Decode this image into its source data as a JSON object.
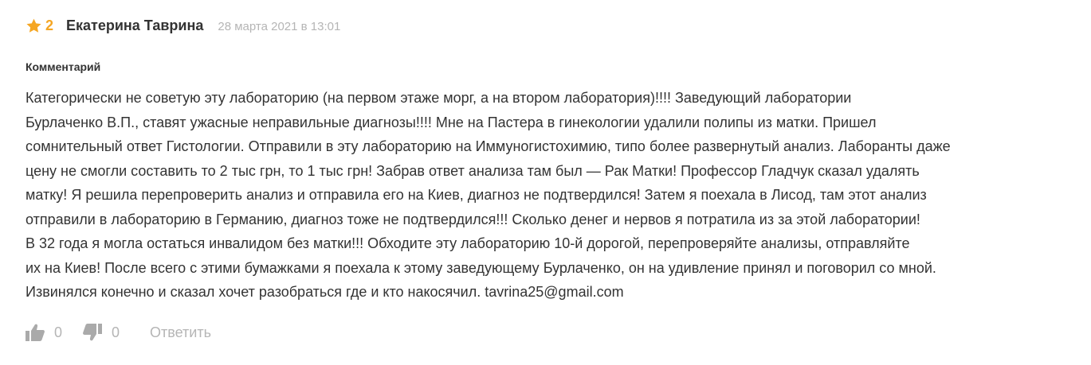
{
  "review": {
    "rating": "2",
    "author": "Екатерина Таврина",
    "date": "28 марта 2021 в 13:01",
    "section_label": "Комментарий",
    "text": "Категорически не советую эту лабораторию (на первом этаже морг, а на втором лаборатория)!!!! Заведующий лаборатории\nБурлаченко В.П., ставят ужасные неправильные диагнозы!!!! Мне на Пастера в гинекологии удалили полипы из матки. Пришел\nсомнительный ответ Гистологии. Отправили в эту лабораторию на Иммуногистохимию, типо более развернутый анализ. Лаборанты даже\nцену не смогли составить то 2 тыс грн, то 1 тыс грн! Забрав ответ анализа там был — Рак Матки! Профессор Гладчук сказал удалять\nматку! Я решила перепроверить анализ и отправила его на Киев, диагноз не подтвердился! Затем я поехала в Лисод, там этот анализ\nотправили в лабораторию в Германию, диагноз тоже не подтвердился!!! Сколько денег и нервов я потратила из за этой лаборатории!\nВ 32 года я могла остаться инвалидом без матки!!! Обходите эту лабораторию 10-й дорогой, перепроверяйте анализы, отправляйте\nих на Киев! После всего с этими бумажками я поехала к этому заведующему Бурлаченко, он на удивление принял и поговорил со мной.\nИзвинялся конечно и сказал хочет разобраться где и кто накосячил. tavrina25@gmail.com"
  },
  "actions": {
    "likes": "0",
    "dislikes": "0",
    "reply_label": "Ответить"
  },
  "icons": {
    "star": "star-icon",
    "like": "thumbs-up-icon",
    "dislike": "thumbs-down-icon"
  },
  "colors": {
    "star": "#f5a623",
    "text": "#333333",
    "muted": "#b5b5b5",
    "thumb": "#aaaaaa"
  }
}
